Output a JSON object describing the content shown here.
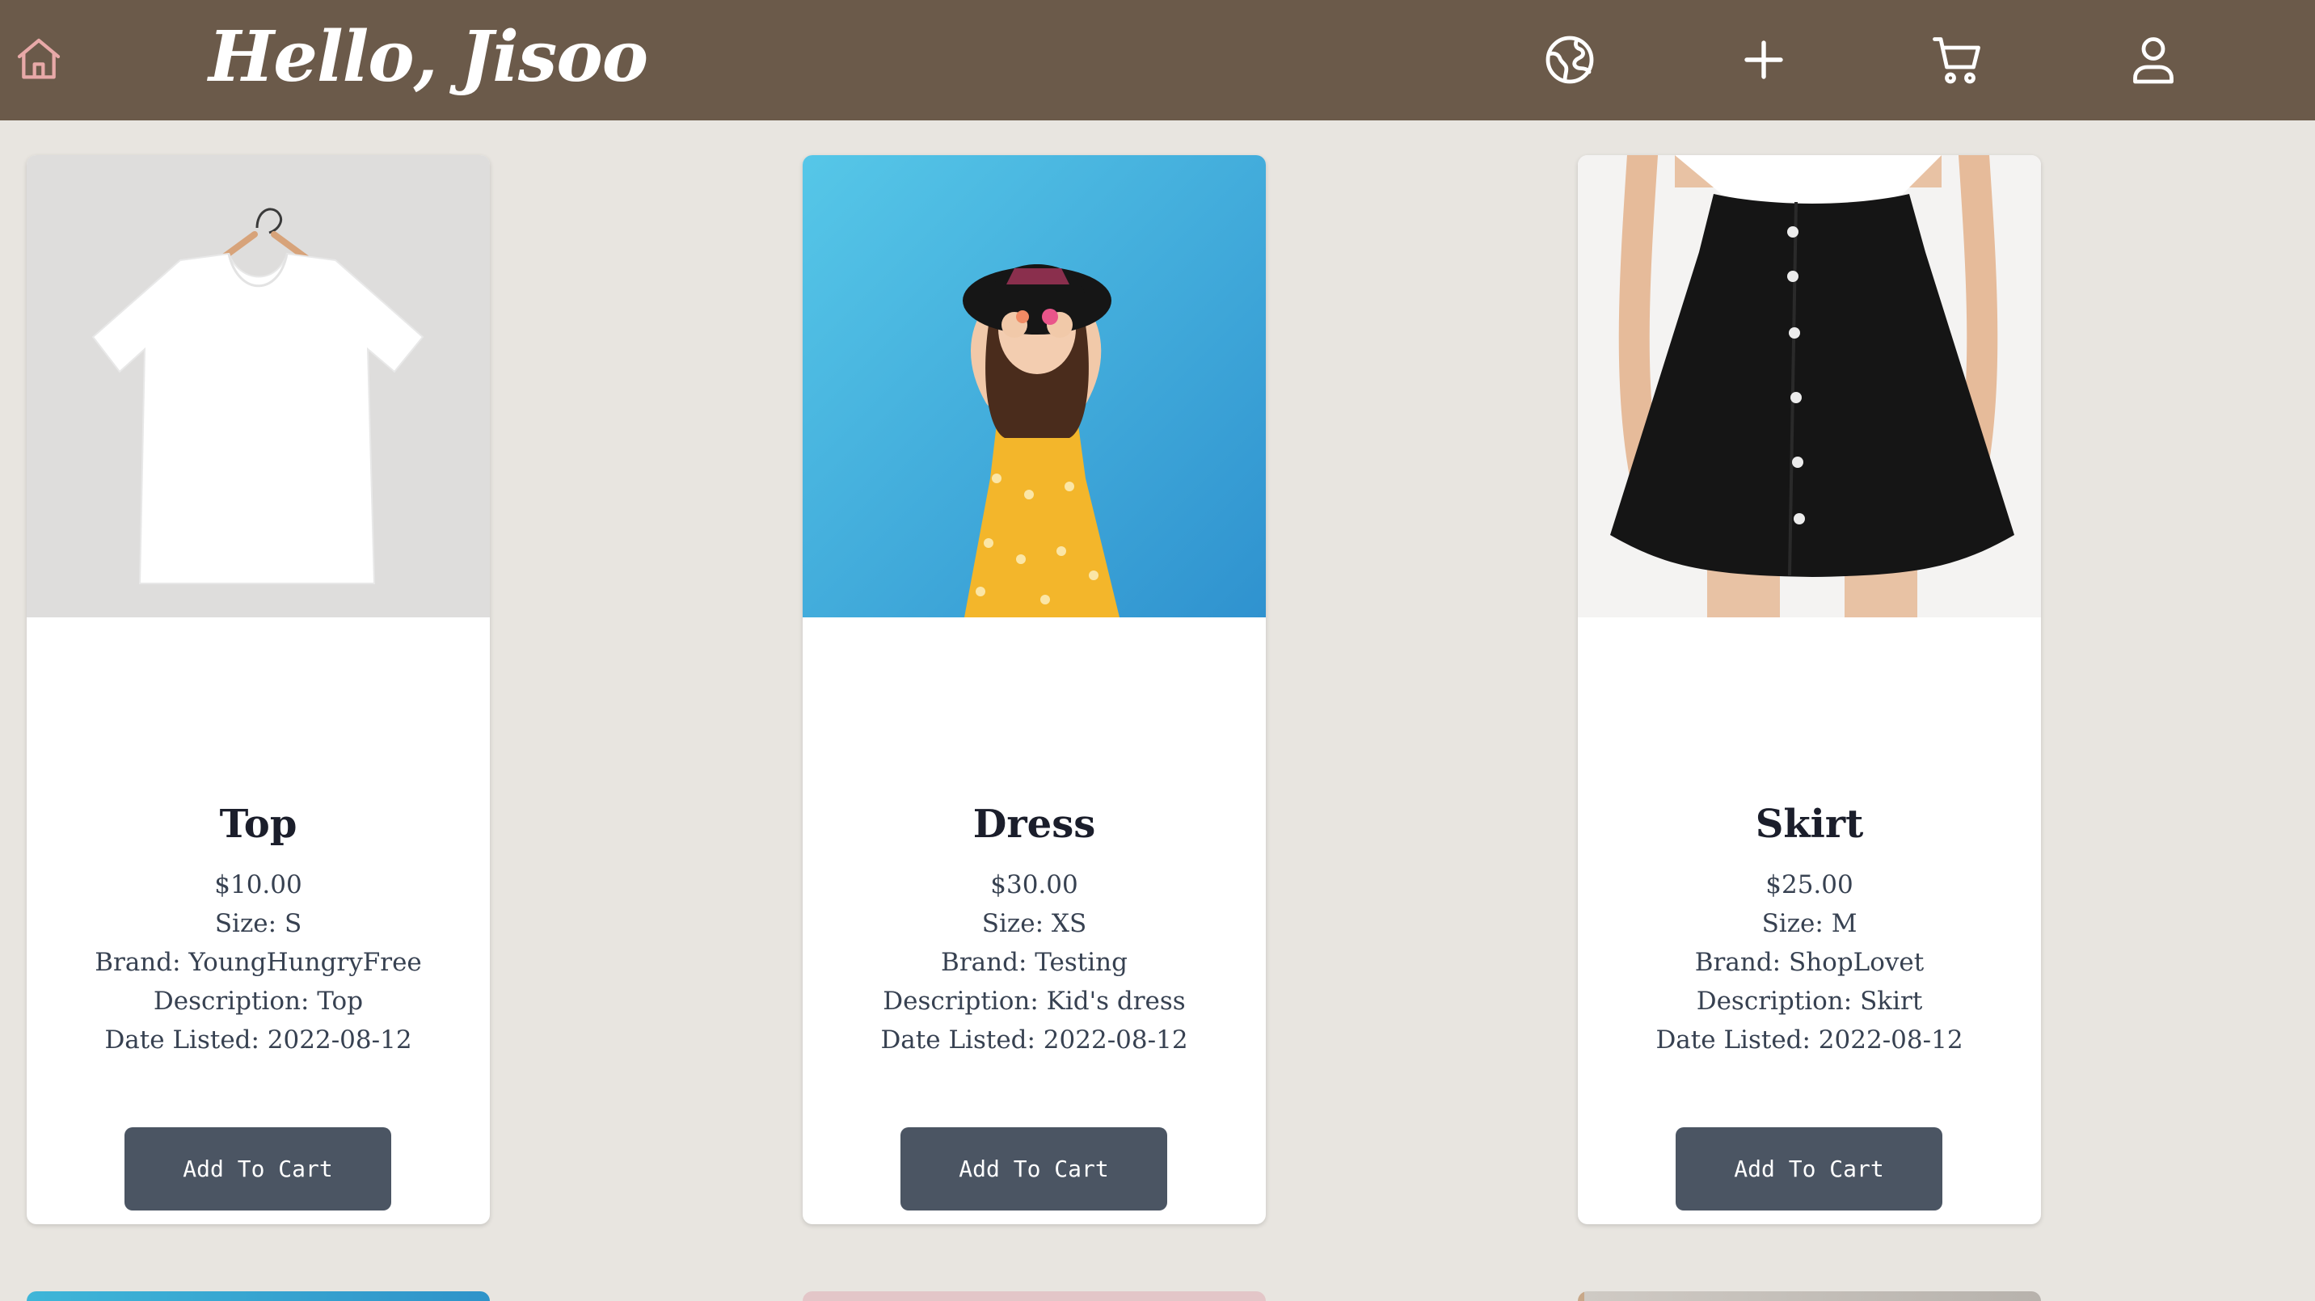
{
  "header": {
    "greeting": "Hello, Jisoo",
    "icons": [
      "home-icon",
      "globe-icon",
      "plus-icon",
      "cart-icon",
      "user-icon"
    ],
    "home_icon_color": "#e8a9a8",
    "bar_color": "#6b5a4a"
  },
  "products": [
    {
      "title": "Top",
      "price": "$10.00",
      "size": "Size: S",
      "brand": "Brand: YoungHungryFree",
      "description": "Description: Top",
      "date": "Date Listed: 2022-08-12",
      "button": "Add To Cart"
    },
    {
      "title": "Dress",
      "price": "$30.00",
      "size": "Size: XS",
      "brand": "Brand: Testing",
      "description": "Description: Kid's dress",
      "date": "Date Listed: 2022-08-12",
      "button": "Add To Cart"
    },
    {
      "title": "Skirt",
      "price": "$25.00",
      "size": "Size: M",
      "brand": "Brand: ShopLovet",
      "description": "Description: Skirt",
      "date": "Date Listed: 2022-08-12",
      "button": "Add To Cart"
    }
  ],
  "colors": {
    "page_bg": "#e8e5e0",
    "button_bg": "#4b5563",
    "title_text": "#1b1e2b"
  }
}
